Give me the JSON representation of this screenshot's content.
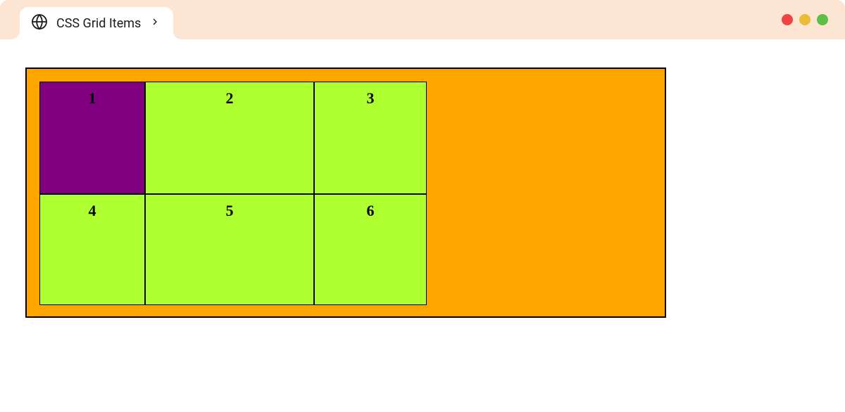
{
  "tab": {
    "title": "CSS Grid Items"
  },
  "grid": {
    "items": {
      "0": "1",
      "1": "2",
      "2": "3",
      "3": "4",
      "4": "5",
      "5": "6"
    }
  },
  "icons": {
    "globe": "globe-icon",
    "chevron": "chevron-right-icon"
  },
  "colors": {
    "chrome_bg": "#FCE6D3",
    "container_bg": "orange",
    "item_normal": "greenyellow",
    "item_highlight": "purple",
    "dot_red": "#EE4444",
    "dot_yellow": "#ECBB38",
    "dot_green": "#5EBE45"
  }
}
